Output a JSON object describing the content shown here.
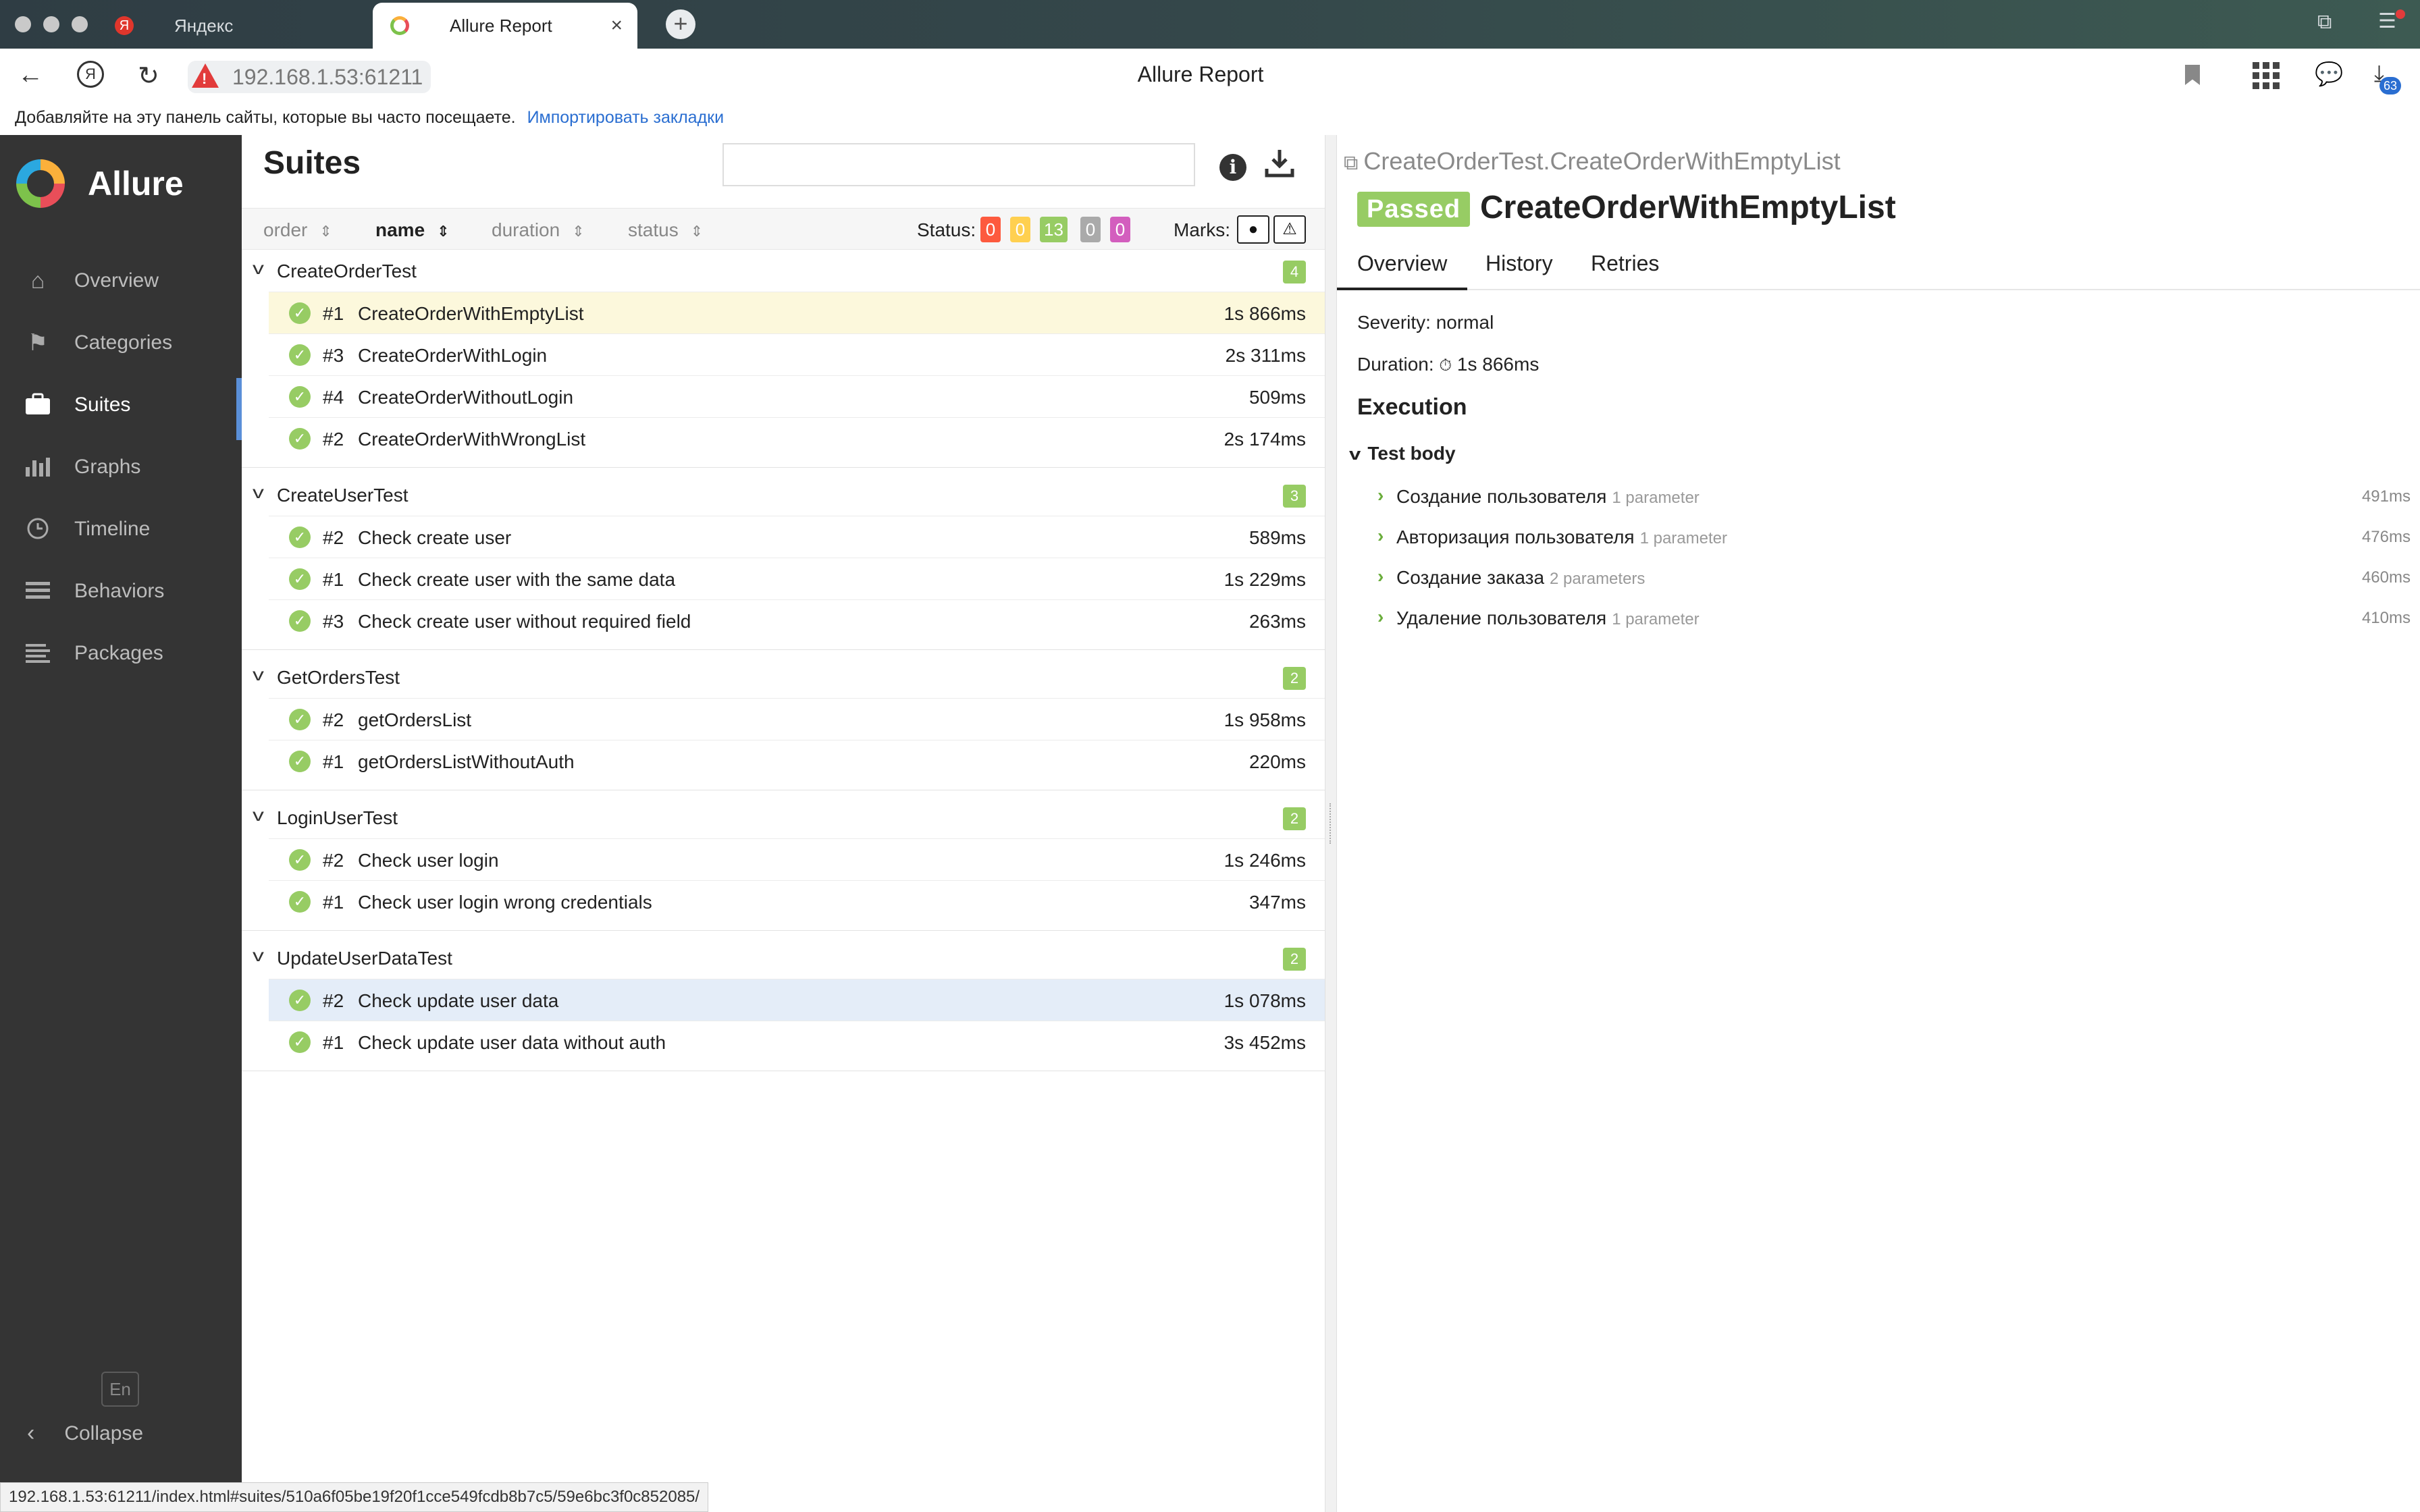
{
  "browser": {
    "tabs": [
      {
        "label": "Яндекс",
        "active": false
      },
      {
        "label": "Allure Report",
        "active": true
      }
    ],
    "url": "192.168.1.53:61211",
    "page_title": "Allure Report",
    "downloads_badge": "63",
    "bookmark_bar": {
      "text": "Добавляйте на эту панель сайты, которые вы часто посещаете.",
      "link": "Импортировать закладки"
    },
    "status_url": "192.168.1.53:61211/index.html#suites/510a6f05be19f20f1cce549fcdb8b7c5/59e6bc3f0c852085/"
  },
  "sidebar": {
    "brand": "Allure",
    "items": [
      {
        "label": "Overview",
        "icon": "home-icon",
        "active": false
      },
      {
        "label": "Categories",
        "icon": "flag-icon",
        "active": false
      },
      {
        "label": "Suites",
        "icon": "briefcase-icon",
        "active": true
      },
      {
        "label": "Graphs",
        "icon": "bar-chart-icon",
        "active": false
      },
      {
        "label": "Timeline",
        "icon": "clock-icon",
        "active": false
      },
      {
        "label": "Behaviors",
        "icon": "list-icon",
        "active": false
      },
      {
        "label": "Packages",
        "icon": "lines-icon",
        "active": false
      }
    ],
    "lang": "En",
    "collapse": "Collapse"
  },
  "suites": {
    "title": "Suites",
    "search_placeholder": "",
    "sort": {
      "order": "order",
      "name": "name",
      "duration": "duration",
      "status": "status"
    },
    "status_label": "Status:",
    "status_counts": [
      {
        "value": "0",
        "color": "#fd5a3e"
      },
      {
        "value": "0",
        "color": "#ffd050"
      },
      {
        "value": "13",
        "color": "#97cc64"
      },
      {
        "value": "0",
        "color": "#aaaaaa"
      },
      {
        "value": "0",
        "color": "#d35ebe"
      }
    ],
    "marks_label": "Marks:",
    "groups": [
      {
        "name": "CreateOrderTest",
        "count": "4",
        "tests": [
          {
            "num": "#1",
            "name": "CreateOrderWithEmptyList",
            "duration": "1s 866ms",
            "highlight": "yellow"
          },
          {
            "num": "#3",
            "name": "CreateOrderWithLogin",
            "duration": "2s 311ms",
            "highlight": ""
          },
          {
            "num": "#4",
            "name": "CreateOrderWithoutLogin",
            "duration": "509ms",
            "highlight": ""
          },
          {
            "num": "#2",
            "name": "CreateOrderWithWrongList",
            "duration": "2s 174ms",
            "highlight": ""
          }
        ]
      },
      {
        "name": "CreateUserTest",
        "count": "3",
        "tests": [
          {
            "num": "#2",
            "name": "Check create user",
            "duration": "589ms",
            "highlight": ""
          },
          {
            "num": "#1",
            "name": "Check create user with the same data",
            "duration": "1s 229ms",
            "highlight": ""
          },
          {
            "num": "#3",
            "name": "Check create user without required field",
            "duration": "263ms",
            "highlight": ""
          }
        ]
      },
      {
        "name": "GetOrdersTest",
        "count": "2",
        "tests": [
          {
            "num": "#2",
            "name": "getOrdersList",
            "duration": "1s 958ms",
            "highlight": ""
          },
          {
            "num": "#1",
            "name": "getOrdersListWithoutAuth",
            "duration": "220ms",
            "highlight": ""
          }
        ]
      },
      {
        "name": "LoginUserTest",
        "count": "2",
        "tests": [
          {
            "num": "#2",
            "name": "Check user login",
            "duration": "1s 246ms",
            "highlight": ""
          },
          {
            "num": "#1",
            "name": "Check user login wrong credentials",
            "duration": "347ms",
            "highlight": ""
          }
        ]
      },
      {
        "name": "UpdateUserDataTest",
        "count": "2",
        "tests": [
          {
            "num": "#2",
            "name": "Check update user data",
            "duration": "1s 078ms",
            "highlight": "blue"
          },
          {
            "num": "#1",
            "name": "Check update user data without auth",
            "duration": "3s 452ms",
            "highlight": ""
          }
        ]
      }
    ]
  },
  "detail": {
    "breadcrumb": "CreateOrderTest.CreateOrderWithEmptyList",
    "status": "Passed",
    "title": "CreateOrderWithEmptyList",
    "tabs": [
      "Overview",
      "History",
      "Retries"
    ],
    "severity": "Severity: normal",
    "duration_label": "Duration:",
    "duration_value": "1s 866ms",
    "execution": "Execution",
    "test_body": "Test body",
    "steps": [
      {
        "name": "Создание пользователя",
        "param": "1 parameter",
        "duration": "491ms"
      },
      {
        "name": "Авторизация пользователя",
        "param": "1 parameter",
        "duration": "476ms"
      },
      {
        "name": "Создание заказа",
        "param": "2 parameters",
        "duration": "460ms"
      },
      {
        "name": "Удаление пользователя",
        "param": "1 parameter",
        "duration": "410ms"
      }
    ]
  }
}
